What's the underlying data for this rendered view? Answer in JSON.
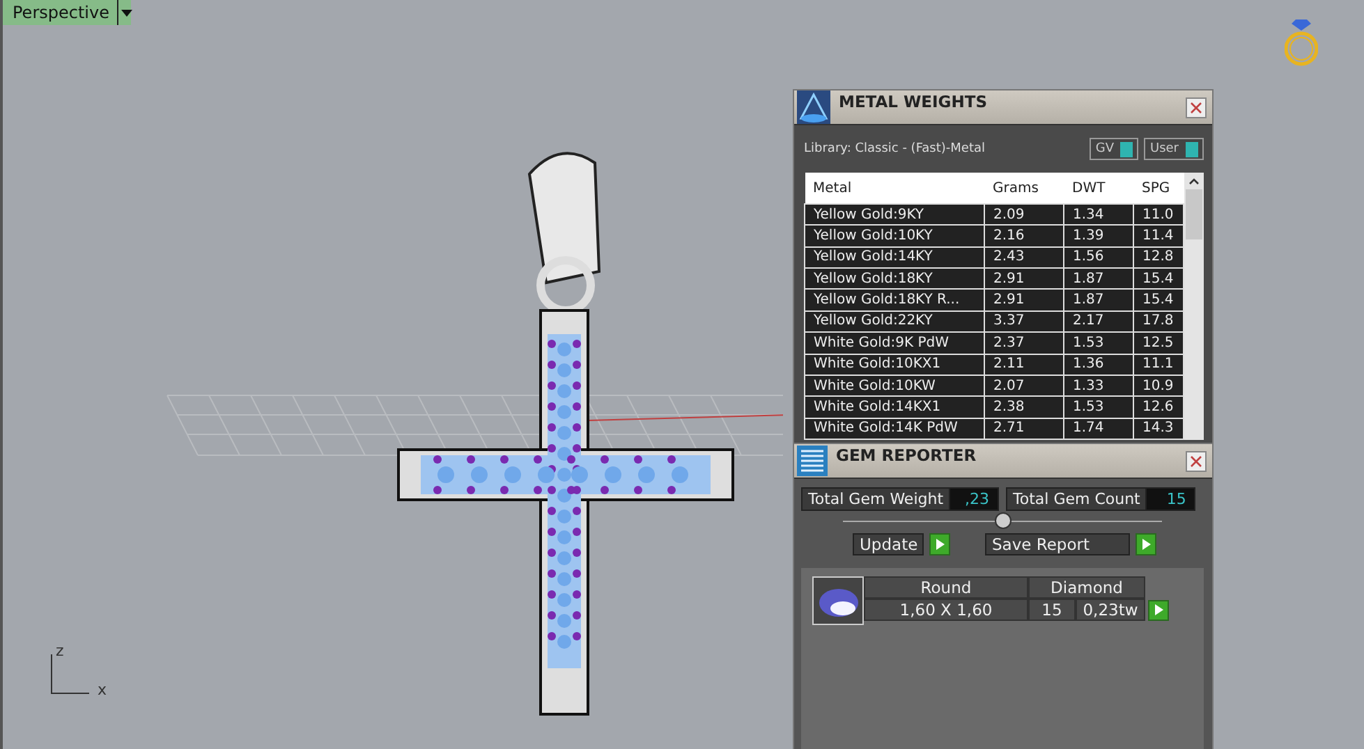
{
  "viewport": {
    "view_label": "Perspective",
    "axes": {
      "z": "z",
      "x": "x"
    }
  },
  "metal_weights": {
    "title": "METAL WEIGHTS",
    "library": "Library: Classic - (Fast)-Metal",
    "toggles": [
      {
        "label": "GV",
        "on": true
      },
      {
        "label": "User",
        "on": true
      }
    ],
    "columns": [
      "Metal",
      "Grams",
      "DWT",
      "SPG"
    ],
    "rows": [
      [
        "Yellow Gold:9KY",
        "2.09",
        "1.34",
        "11.0"
      ],
      [
        "Yellow Gold:10KY",
        "2.16",
        "1.39",
        "11.4"
      ],
      [
        "Yellow Gold:14KY",
        "2.43",
        "1.56",
        "12.8"
      ],
      [
        "Yellow Gold:18KY",
        "2.91",
        "1.87",
        "15.4"
      ],
      [
        "Yellow Gold:18KY R...",
        "2.91",
        "1.87",
        "15.4"
      ],
      [
        "Yellow Gold:22KY",
        "3.37",
        "2.17",
        "17.8"
      ],
      [
        "White Gold:9K PdW",
        "2.37",
        "1.53",
        "12.5"
      ],
      [
        "White Gold:10KX1",
        "2.11",
        "1.36",
        "11.1"
      ],
      [
        "White Gold:10KW",
        "2.07",
        "1.33",
        "10.9"
      ],
      [
        "White Gold:14KX1",
        "2.38",
        "1.53",
        "12.6"
      ],
      [
        "White Gold:14K PdW",
        "2.71",
        "1.74",
        "14.3"
      ]
    ]
  },
  "gem_reporter": {
    "title": "GEM REPORTER",
    "totals": [
      {
        "label": "Total Gem Weight",
        "value": ",23"
      },
      {
        "label": "Total Gem Count",
        "value": "15"
      }
    ],
    "buttons": [
      "Update",
      "Save Report"
    ],
    "gems": [
      {
        "shape": "Round",
        "size": "1,60 X 1,60",
        "material": "Diamond",
        "count": "15",
        "weight": "0,23tw"
      }
    ]
  }
}
